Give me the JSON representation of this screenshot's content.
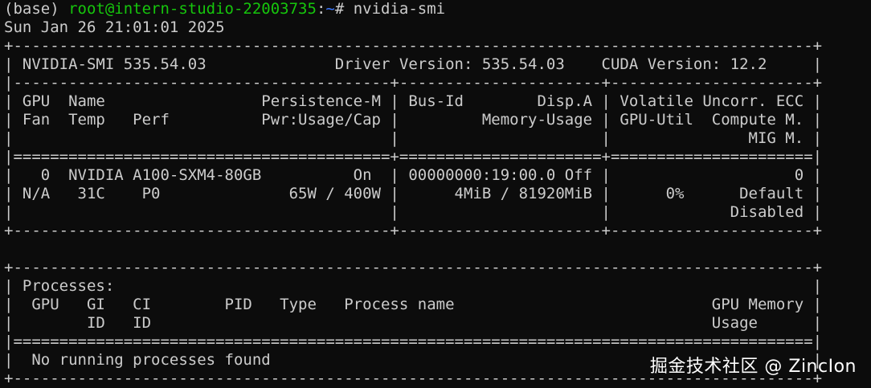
{
  "prompt": {
    "env": "(base) ",
    "user_host": "root@intern-studio-22003735",
    "colon": ":",
    "path": "~",
    "symbol": "# ",
    "command": "nvidia-smi"
  },
  "date_line": "Sun Jan 26 21:01:01 2025",
  "output_lines": [
    "+---------------------------------------------------------------------------------------+",
    "| NVIDIA-SMI 535.54.03              Driver Version: 535.54.03    CUDA Version: 12.2     |",
    "|-----------------------------------------+----------------------+----------------------+",
    "| GPU  Name                 Persistence-M | Bus-Id        Disp.A | Volatile Uncorr. ECC |",
    "| Fan  Temp   Perf          Pwr:Usage/Cap |         Memory-Usage | GPU-Util  Compute M. |",
    "|                                         |                      |               MIG M. |",
    "|=========================================+======================+======================|",
    "|   0  NVIDIA A100-SXM4-80GB          On  | 00000000:19:00.0 Off |                    0 |",
    "| N/A   31C    P0              65W / 400W |      4MiB / 81920MiB |      0%      Default |",
    "|                                         |                      |             Disabled |",
    "+-----------------------------------------+----------------------+----------------------+",
    "",
    "+---------------------------------------------------------------------------------------+",
    "| Processes:                                                                            |",
    "|  GPU   GI   CI        PID   Type   Process name                            GPU Memory |",
    "|        ID   ID                                                             Usage      |",
    "|=======================================================================================|",
    "|  No running processes found                                                           |",
    "+---------------------------------------------------------------------------------------+"
  ],
  "watermark": "掘金技术社区 @ ZincIon",
  "colors": {
    "background": "#0c0c0c",
    "text": "#cccccc",
    "user_host": "#16c60c",
    "path": "#3b78ff"
  }
}
